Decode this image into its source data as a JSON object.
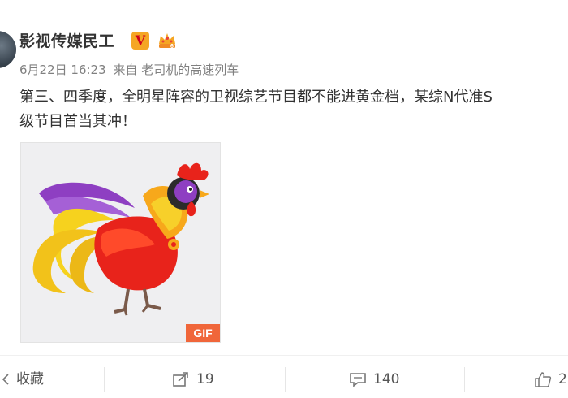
{
  "post": {
    "username": "影视传媒民工",
    "verified_mark": "V",
    "meta_date": "6月22日 16:23",
    "meta_source_prefix": "来自",
    "meta_source": "老司机的高速列车",
    "text_line1": "第三、四季度，全明星阵容的卫视综艺节目都不能进黄金档，某综N代准S",
    "text_line2": "级节目首当其冲！",
    "image_badge": "GIF"
  },
  "actions": {
    "favorite_label": "收藏",
    "repost_count": "19",
    "comment_count": "140",
    "like_count": "2"
  },
  "icons": {
    "favorite": "star-icon",
    "repost": "share-icon",
    "comment": "comment-icon",
    "like": "thumbs-up-icon"
  },
  "colors": {
    "verified_bg": "#f5a623",
    "verified_text": "#d0021b",
    "gif_badge": "#f0663a",
    "meta_text": "#808080"
  }
}
